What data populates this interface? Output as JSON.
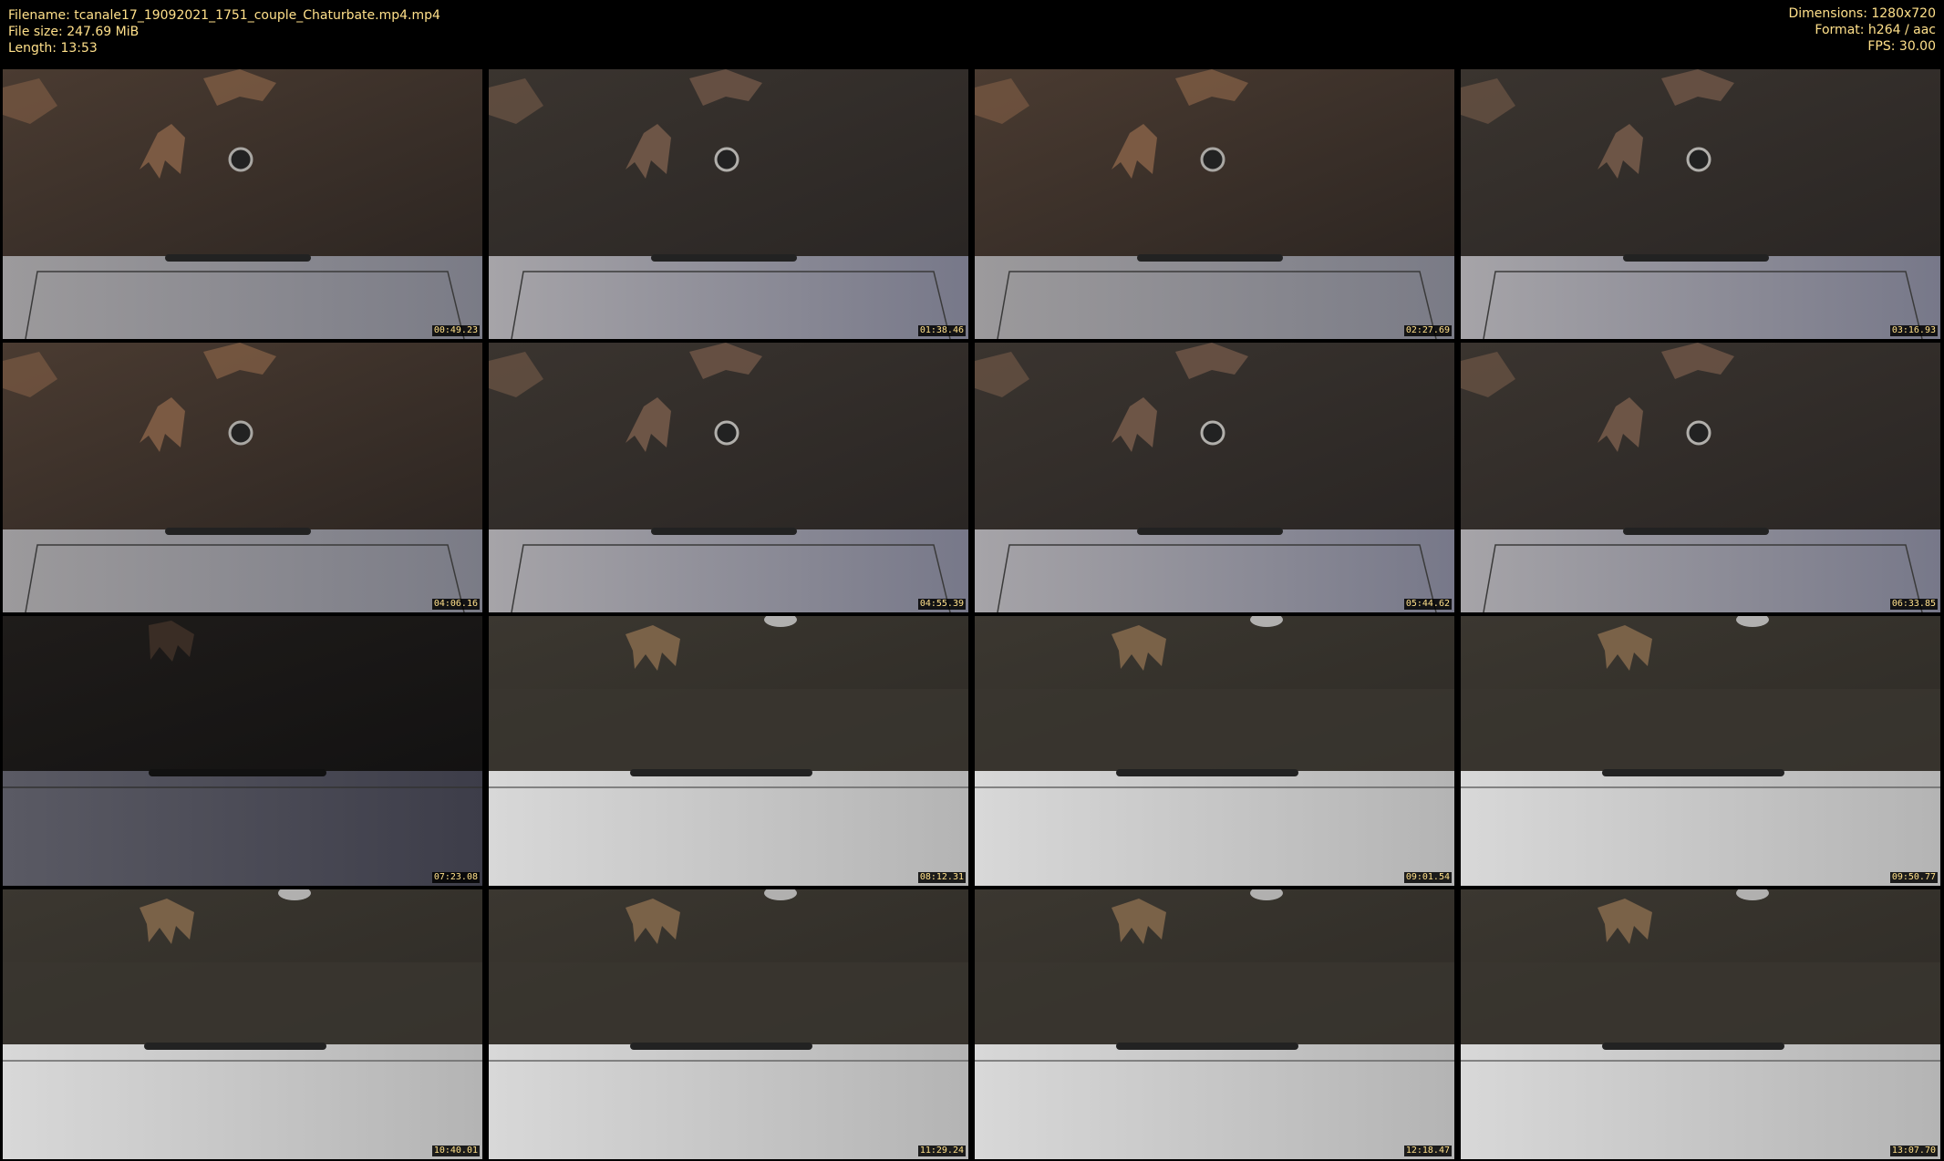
{
  "header": {
    "filename": "Filename: tcanale17_19092021_1751_couple_Chaturbate.mp4.mp4",
    "filesize": "File size: 247.69 MiB",
    "length": "Length: 13:53",
    "dimensions": "Dimensions: 1280x720",
    "format": "Format: h264 / aac",
    "fps": "FPS: 30.00"
  },
  "colors": {
    "header_text": "#ffe08a",
    "background": "#000000"
  },
  "thumbnails": [
    {
      "timestamp": "00:49.23",
      "scene": "brown"
    },
    {
      "timestamp": "01:38.46",
      "scene": "grey"
    },
    {
      "timestamp": "02:27.69",
      "scene": "brown"
    },
    {
      "timestamp": "03:16.93",
      "scene": "grey"
    },
    {
      "timestamp": "04:06.16",
      "scene": "brown"
    },
    {
      "timestamp": "04:55.39",
      "scene": "grey"
    },
    {
      "timestamp": "05:44.62",
      "scene": "grey"
    },
    {
      "timestamp": "06:33.85",
      "scene": "grey"
    },
    {
      "timestamp": "07:23.08",
      "scene": "dark"
    },
    {
      "timestamp": "08:12.31",
      "scene": "bright"
    },
    {
      "timestamp": "09:01.54",
      "scene": "bright"
    },
    {
      "timestamp": "09:50.77",
      "scene": "bright"
    },
    {
      "timestamp": "10:40.01",
      "scene": "bright"
    },
    {
      "timestamp": "11:29.24",
      "scene": "bright"
    },
    {
      "timestamp": "12:18.47",
      "scene": "bright"
    },
    {
      "timestamp": "13:07.70",
      "scene": "bright"
    }
  ]
}
